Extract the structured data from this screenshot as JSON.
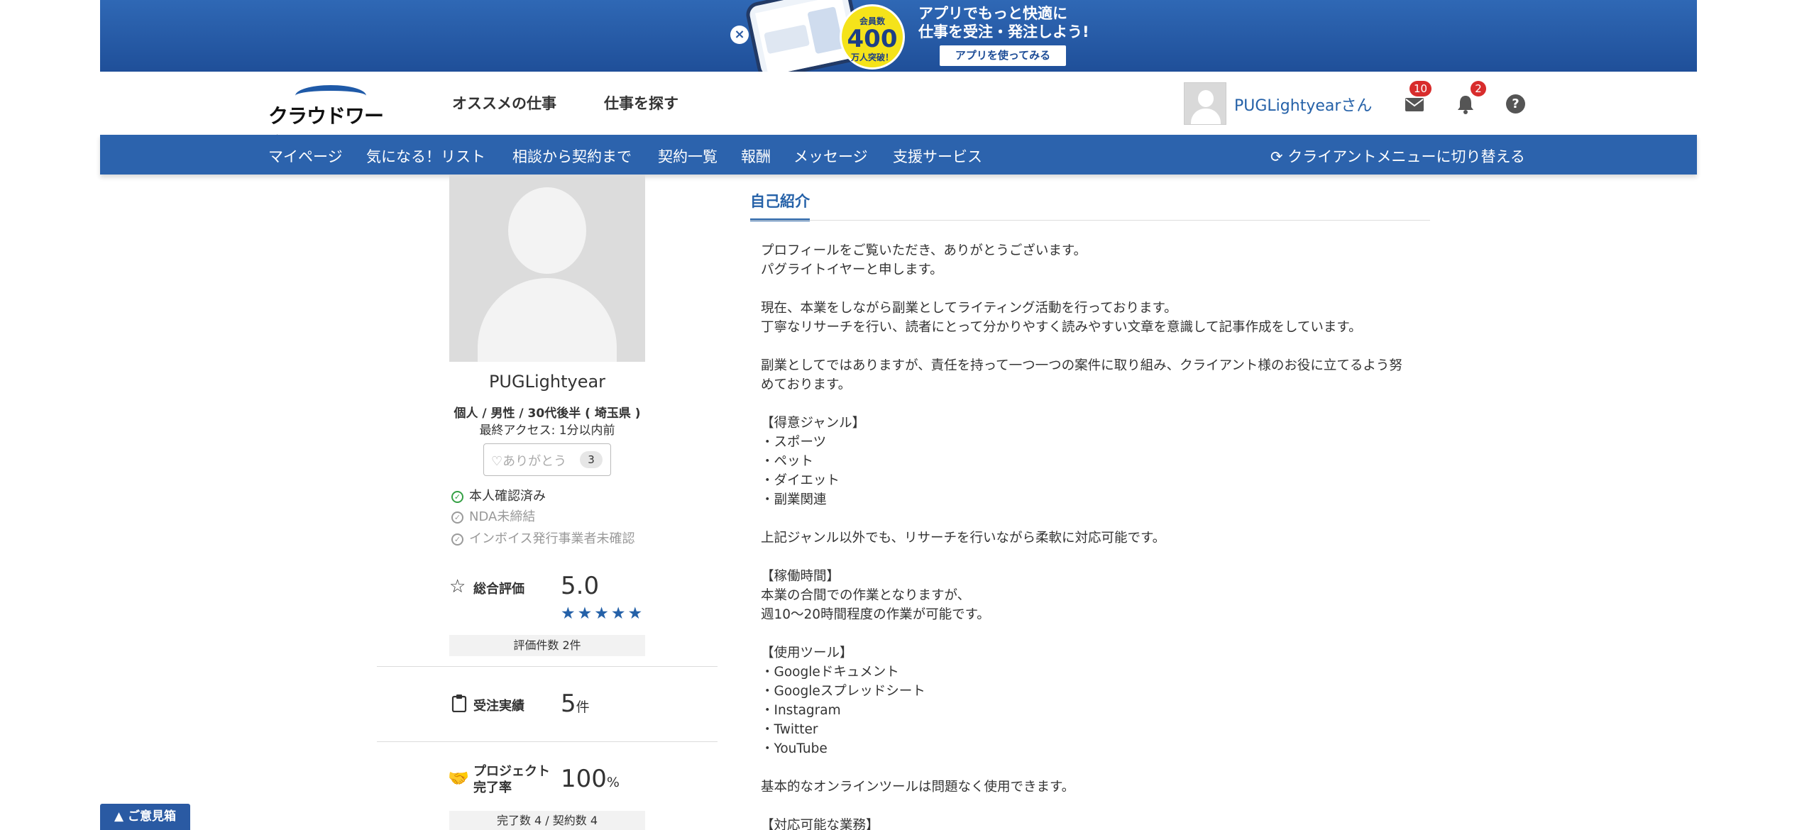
{
  "banner": {
    "medal_top": "会員数",
    "medal_num": "400",
    "medal_bottom": "万人突破！",
    "line1": "アプリでもっと快適に",
    "line2": "仕事を受注・発注しよう!",
    "button": "アプリを使ってみる"
  },
  "header": {
    "logo": "クラウドワークス",
    "nav": [
      "オススメの仕事",
      "仕事を探す"
    ],
    "username": "PUGLightyearさん",
    "messages_badge": "10",
    "notifications_badge": "2",
    "help": "?"
  },
  "subnav": {
    "items": [
      "マイページ",
      "気になる！リスト",
      "相談から契約まで",
      "契約一覧",
      "報酬",
      "メッセージ",
      "支援サービス"
    ],
    "switch": "クライアントメニューに切り替える"
  },
  "profile": {
    "name": "PUGLightyear",
    "meta": "個人 / 男性 / 30代後半 ( 埼玉県 )",
    "last_access": "最終アクセス: 1分以内前",
    "thanks_label": "ありがとう",
    "thanks_count": "3",
    "checks": [
      "本人確認済み",
      "NDA未締結",
      "インボイス発行事業者未確認"
    ],
    "rating_label": "総合評価",
    "rating_value": "5.0",
    "rating_stars": 5,
    "rating_count": "評価件数 2件",
    "orders_label": "受注実績",
    "orders_value": "5",
    "orders_unit": "件",
    "completion_label_1": "プロジェクト",
    "completion_label_2": "完了率",
    "completion_value": "100",
    "completion_unit": "%",
    "completion_detail": "完了数 4 / 契約数 4"
  },
  "main": {
    "tab": "自己紹介",
    "intro_lines": [
      "プロフィールをご覧いただき、ありがとうございます。",
      "パグライトイヤーと申します。",
      "",
      "現在、本業をしながら副業としてライティング活動を行っております。",
      "丁寧なリサーチを行い、読者にとって分かりやすく読みやすい文章を意識して記事作成をしています。",
      "",
      "副業としてではありますが、責任を持って一つ一つの案件に取り組み、クライアント様のお役に立てるよう努",
      "めております。",
      "",
      "【得意ジャンル】",
      "・スポーツ",
      "・ペット",
      "・ダイエット",
      "・副業関連",
      "",
      "上記ジャンル以外でも、リサーチを行いながら柔軟に対応可能です。",
      "",
      "【稼働時間】",
      "本業の合間での作業となりますが、",
      "週10〜20時間程度の作業が可能です。",
      "",
      "【使用ツール】",
      "・Googleドキュメント",
      "・Googleスプレッドシート",
      "・Instagram",
      "・Twitter",
      "・YouTube",
      "",
      "基本的なオンラインツールは問題なく使用できます。",
      "",
      "【対応可能な業務】"
    ]
  },
  "feedback": "▲ ご意見箱"
}
